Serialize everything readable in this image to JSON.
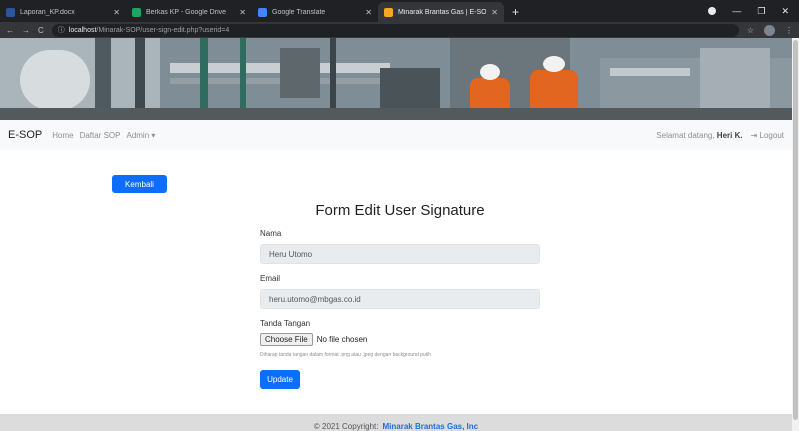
{
  "browser": {
    "tabs": [
      {
        "label": "Laporan_KP.docx",
        "color": "#2b579a",
        "active": false
      },
      {
        "label": "Berkas KP - Google Drive",
        "color": "#1fa463",
        "active": false
      },
      {
        "label": "Google Translate",
        "color": "#4285f4",
        "active": false
      },
      {
        "label": "Minarak Brantas Gas | E-SOP",
        "color": "#f5a623",
        "active": true
      }
    ],
    "new_tab": "+",
    "url_host": "localhost",
    "url_path": "/Minarak-SOP/user-sign-edit.php?userid=4"
  },
  "navbar": {
    "brand": "E-SOP",
    "links": [
      "Home",
      "Daftar SOP",
      "Admin ▾"
    ],
    "greeting": "Selamat datang,",
    "user": "Heri K.",
    "logout": "Logout"
  },
  "page": {
    "back_label": "Kembali",
    "title": "Form Edit User Signature",
    "nama_label": "Nama",
    "nama_value": "Heru Utomo",
    "email_label": "Email",
    "email_value": "heru.utomo@mbgas.co.id",
    "ttd_label": "Tanda Tangan",
    "choose_file": "Choose File",
    "no_file": "No file chosen",
    "hint": "Diharap tanda tangan dalam format .png atau .jpeg dengan background putih",
    "update_label": "Update"
  },
  "footer": {
    "text": "© 2021 Copyright:",
    "company": "Minarak Brantas Gas, Inc"
  },
  "colors": {
    "primary": "#0d6efd",
    "footer_link": "#1a6fe0"
  }
}
